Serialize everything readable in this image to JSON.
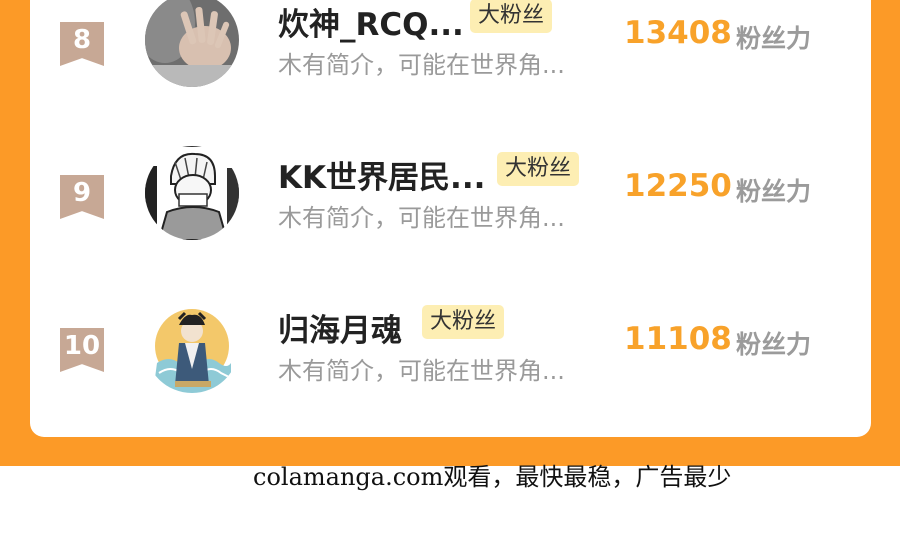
{
  "ranking": {
    "entries": [
      {
        "rank": "8",
        "name": "炊神_RCQ...",
        "badge": "大粉丝",
        "bio": "木有简介，可能在世界角...",
        "score": "13408",
        "score_label": "粉丝力"
      },
      {
        "rank": "9",
        "name": "KK世界居民...",
        "badge": "大粉丝",
        "bio": "木有简介，可能在世界角...",
        "score": "12250",
        "score_label": "粉丝力"
      },
      {
        "rank": "10",
        "name": "归海月魂",
        "badge": "大粉丝",
        "bio": "木有简介，可能在世界角...",
        "score": "11108",
        "score_label": "粉丝力"
      }
    ]
  },
  "footer": {
    "watermark": "colamanga.com观看，最快最稳，广告最少"
  },
  "colors": {
    "frame_orange": "#fc9a27",
    "score_orange": "#f8a22a",
    "badge_bg": "#fdeeb3",
    "rank_tag": "#c7a895"
  }
}
